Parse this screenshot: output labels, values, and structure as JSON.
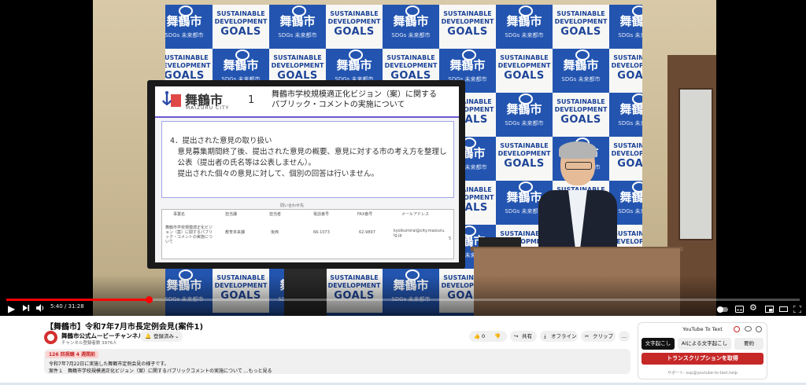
{
  "video": {
    "slide": {
      "city_jp": "舞鶴市",
      "city_en": "MAIZURU CITY",
      "number": "1",
      "title_line1": "舞鶴市学校規模適正化ビジョン（案）に関する",
      "title_line2": "パブリック・コメントの実施について",
      "body": [
        "4．提出された意見の取り扱い",
        "　意見募集期間終了後、提出された意見の概要、意見に対する市の考え方を整理し",
        "　公表（提出者の氏名等は公表しません）。",
        "　提出された個々の意見に対して、個別の回答は行いません。"
      ],
      "table_caption": "問い合わせ先",
      "table_headers": [
        "事業名",
        "担当課",
        "担当者",
        "電話番号",
        "FAX番号",
        "メールアドレス"
      ],
      "table_row": [
        "舞鶴市学校規模適正化ビジョン（案）に関するパブリック・コメントの実施について",
        "教育未来課",
        "後西",
        "66-1073",
        "62-9897",
        "kyoikumirai@city.maizuru.lg.jp"
      ],
      "page": "5"
    },
    "banner_tile_text": {
      "sdg": "SUSTAINABLE DEVELOPMENT",
      "goals": "GOALS",
      "city": "舞鶴市",
      "sub": "SDGs 未来都市"
    },
    "time_current": "5:40",
    "time_total": "31:28",
    "time_display": "5:40 / 31:28",
    "progress": 0.18
  },
  "controls": {
    "play_icon": "▶",
    "next_icon": "⏭",
    "volume_icon": "🔊",
    "autoplay_icon": "autoplay-toggle",
    "subtitles_icon": "subtitles",
    "settings_icon": "⚙",
    "miniplayer_icon": "miniplayer",
    "theater_icon": "theater",
    "fullscreen_icon": "fullscreen"
  },
  "info": {
    "title": "【舞鶴市】令和7年7月市長定例会見(案件1)",
    "channel_name": "舞鶴市公式ムービーチャンネル",
    "subscribers": "チャンネル登録者数 3976人",
    "subscribe_label": "登録済み",
    "like_count": "0",
    "share_label": "共有",
    "offline_label": "オフライン",
    "clip_label": "クリップ",
    "more_label": "…",
    "views_meta": "126 回視聴  4 週間前",
    "desc_line1": "令和7年7月22日に実施した舞鶴市定例会見の様子です。",
    "desc_line2": "案件１　舞鶴市学校規模適正化ビジョン（案）に関するパブリックコメントの実施について ...もっと見る"
  },
  "extension": {
    "title": "YouTube To Text",
    "tab1": "文字起こし",
    "tab2": "AIによる文字起こし",
    "tab3": "要約",
    "main_button": "トランスクリプションを取得",
    "support": "サポート: sup@youtube-to-text.help",
    "colors": {
      "record": "#c62828"
    }
  },
  "colors": {
    "progress": "#ff0000",
    "banner": "#2355b0"
  }
}
